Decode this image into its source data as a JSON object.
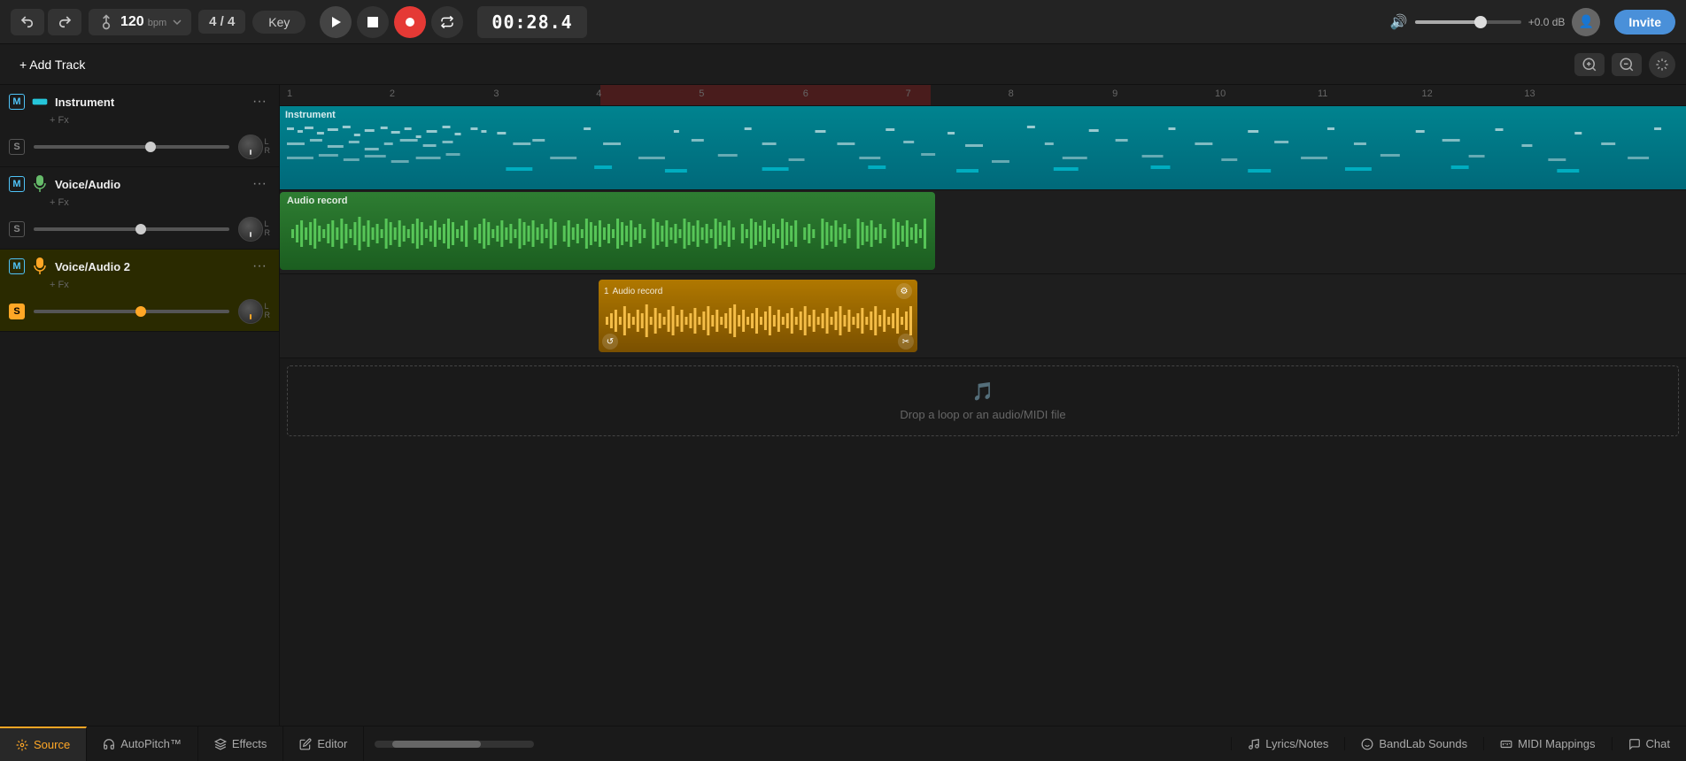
{
  "toolbar": {
    "undo_label": "↩",
    "redo_label": "↪",
    "tempo": "120",
    "tempo_unit": "bpm",
    "time_sig": "4 / 4",
    "key_label": "Key",
    "play_label": "▶",
    "stop_label": "■",
    "record_label": "●",
    "loop_label": "⟳",
    "time_display": "00:28.4",
    "volume_db": "+0.0 dB",
    "invite_label": "Invite"
  },
  "second_toolbar": {
    "add_track_label": "+ Add Track",
    "midi_icon": "⌖"
  },
  "tracks": [
    {
      "id": "instrument",
      "name": "Instrument",
      "type": "instrument",
      "icon": "🎹",
      "m_active": true,
      "s_active": false,
      "fx_label": "+ Fx",
      "volume_pct": 60,
      "menu_label": "···"
    },
    {
      "id": "voice-audio",
      "name": "Voice/Audio",
      "type": "voice",
      "icon": "🎤",
      "m_active": true,
      "s_active": false,
      "fx_label": "+ Fx",
      "volume_pct": 55,
      "menu_label": "···"
    },
    {
      "id": "voice-audio2",
      "name": "Voice/Audio 2",
      "type": "voice2",
      "icon": "🎤",
      "m_active": true,
      "s_active": true,
      "fx_label": "+ Fx",
      "volume_pct": 55,
      "menu_label": "···"
    }
  ],
  "clips": {
    "instrument_label": "Instrument",
    "audio_green_label": "Audio record",
    "audio_orange_label": "Audio record",
    "audio_orange_num": "1",
    "drop_zone_label": "Drop a loop or an audio/MIDI file",
    "drop_zone_icon": "🎵"
  },
  "ruler": {
    "marks": [
      "1",
      "2",
      "3",
      "4",
      "5",
      "6",
      "7",
      "8",
      "9",
      "10",
      "11",
      "12",
      "13"
    ]
  },
  "bottom_toolbar": {
    "source_label": "Source",
    "autopitch_label": "AutoPitch™",
    "effects_label": "Effects",
    "editor_label": "Editor",
    "lyrics_label": "Lyrics/Notes",
    "bandlab_label": "BandLab Sounds",
    "midi_mappings_label": "MIDI Mappings",
    "chat_label": "Chat"
  }
}
